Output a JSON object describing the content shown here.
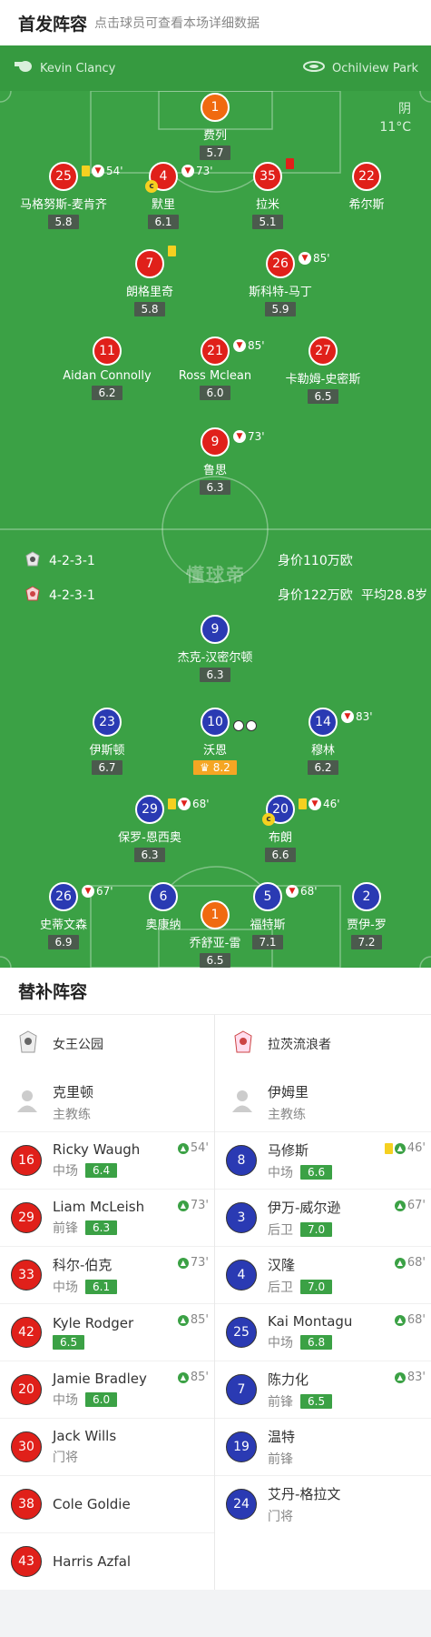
{
  "header": {
    "title": "首发阵容",
    "subtitle": "点击球员可查看本场详细数据"
  },
  "match": {
    "referee": "Kevin Clancy",
    "stadium": "Ochilview Park",
    "weather": "阴",
    "temperature": "11°C",
    "home_formation": "4-2-3-1",
    "home_value": "身价110万欧",
    "away_formation": "4-2-3-1",
    "away_value": "身价122万欧",
    "away_avg_age": "平均28.8岁",
    "watermark": "懂球帝"
  },
  "home_players": [
    {
      "num": "1",
      "name": "费列",
      "rating": "5.7"
    },
    {
      "num": "25",
      "name": "马格努斯-麦肯齐",
      "rating": "5.8",
      "event_time": "54'"
    },
    {
      "num": "4",
      "name": "默里",
      "rating": "6.1",
      "event_time": "73'",
      "captain": "c"
    },
    {
      "num": "35",
      "name": "拉米",
      "rating": "5.1"
    },
    {
      "num": "22",
      "name": "希尔斯",
      "rating": ""
    },
    {
      "num": "7",
      "name": "朗格里奇",
      "rating": "5.8"
    },
    {
      "num": "26",
      "name": "斯科特-马丁",
      "rating": "5.9",
      "event_time": "85'"
    },
    {
      "num": "11",
      "name": "Aidan Connolly",
      "rating": "6.2"
    },
    {
      "num": "21",
      "name": "Ross Mclean",
      "rating": "6.0",
      "event_time": "85'"
    },
    {
      "num": "27",
      "name": "卡勒姆-史密斯",
      "rating": "6.5"
    },
    {
      "num": "9",
      "name": "鲁思",
      "rating": "6.3",
      "event_time": "73'"
    }
  ],
  "away_players": [
    {
      "num": "9",
      "name": "杰克-汉密尔顿",
      "rating": "6.3"
    },
    {
      "num": "23",
      "name": "伊斯顿",
      "rating": "6.7"
    },
    {
      "num": "10",
      "name": "沃恩",
      "rating": "8.2"
    },
    {
      "num": "14",
      "name": "穆林",
      "rating": "6.2",
      "event_time": "83'"
    },
    {
      "num": "29",
      "name": "保罗-恩西奥",
      "rating": "6.3",
      "event_time": "68'"
    },
    {
      "num": "20",
      "name": "布朗",
      "rating": "6.6",
      "event_time": "46'",
      "captain": "c"
    },
    {
      "num": "26",
      "name": "史蒂文森",
      "rating": "6.9",
      "event_time": "67'"
    },
    {
      "num": "6",
      "name": "奥康纳",
      "rating": ""
    },
    {
      "num": "5",
      "name": "福特斯",
      "rating": "7.1",
      "event_time": "68'"
    },
    {
      "num": "2",
      "name": "贾伊-罗",
      "rating": "7.2"
    },
    {
      "num": "1",
      "name": "乔舒亚-雷",
      "rating": "6.5"
    }
  ],
  "subs": {
    "title": "替补阵容",
    "home": {
      "team": "女王公园",
      "coach": "克里顿",
      "coach_role": "主教练",
      "players": [
        {
          "num": "16",
          "name": "Ricky Waugh",
          "pos": "中场",
          "rating": "6.4",
          "time": "54'"
        },
        {
          "num": "29",
          "name": "Liam McLeish",
          "pos": "前锋",
          "rating": "6.3",
          "time": "73'"
        },
        {
          "num": "33",
          "name": "科尔-伯克",
          "pos": "中场",
          "rating": "6.1",
          "time": "73'"
        },
        {
          "num": "42",
          "name": "Kyle Rodger",
          "pos": "",
          "rating": "6.5",
          "time": "85'"
        },
        {
          "num": "20",
          "name": "Jamie Bradley",
          "pos": "中场",
          "rating": "6.0",
          "time": "85'"
        },
        {
          "num": "30",
          "name": "Jack Wills",
          "pos": "门将",
          "rating": "",
          "time": ""
        },
        {
          "num": "38",
          "name": "Cole Goldie",
          "pos": "",
          "rating": "",
          "time": ""
        },
        {
          "num": "43",
          "name": "Harris Azfal",
          "pos": "",
          "rating": "",
          "time": ""
        }
      ]
    },
    "away": {
      "team": "拉茨流浪者",
      "coach": "伊姆里",
      "coach_role": "主教练",
      "players": [
        {
          "num": "8",
          "name": "马修斯",
          "pos": "中场",
          "rating": "6.6",
          "time": "46'"
        },
        {
          "num": "3",
          "name": "伊万-威尔逊",
          "pos": "后卫",
          "rating": "7.0",
          "time": "67'"
        },
        {
          "num": "4",
          "name": "汉隆",
          "pos": "后卫",
          "rating": "7.0",
          "time": "68'"
        },
        {
          "num": "25",
          "name": "Kai Montagu",
          "pos": "中场",
          "rating": "6.8",
          "time": "68'"
        },
        {
          "num": "7",
          "name": "陈力化",
          "pos": "前锋",
          "rating": "6.5",
          "time": "83'"
        },
        {
          "num": "19",
          "name": "温特",
          "pos": "前锋",
          "rating": "",
          "time": ""
        },
        {
          "num": "24",
          "name": "艾丹-格拉文",
          "pos": "门将",
          "rating": "",
          "time": ""
        }
      ]
    }
  }
}
